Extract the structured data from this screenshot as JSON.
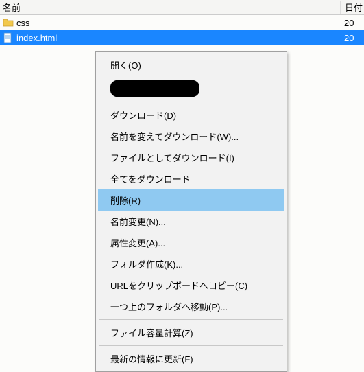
{
  "columns": {
    "name": "名前",
    "date": "日付"
  },
  "files": [
    {
      "name": "css",
      "icon": "folder-icon",
      "date": "20",
      "selected": false
    },
    {
      "name": "index.html",
      "icon": "html-file-icon",
      "date": "20",
      "selected": true
    }
  ],
  "context_menu": {
    "items": [
      {
        "label": "開く(O)",
        "type": "item"
      },
      {
        "type": "redacted"
      },
      {
        "type": "sep"
      },
      {
        "label": "ダウンロード(D)",
        "type": "item"
      },
      {
        "label": "名前を変えてダウンロード(W)...",
        "type": "item"
      },
      {
        "label": "ファイルとしてダウンロード(I)",
        "type": "item"
      },
      {
        "label": "全てをダウンロード",
        "type": "item"
      },
      {
        "label": "削除(R)",
        "type": "item",
        "highlight": true
      },
      {
        "label": "名前変更(N)...",
        "type": "item"
      },
      {
        "label": "属性変更(A)...",
        "type": "item"
      },
      {
        "label": "フォルダ作成(K)...",
        "type": "item"
      },
      {
        "label": "URLをクリップボードへコピー(C)",
        "type": "item"
      },
      {
        "label": "一つ上のフォルダへ移動(P)...",
        "type": "item"
      },
      {
        "type": "sep"
      },
      {
        "label": "ファイル容量計算(Z)",
        "type": "item"
      },
      {
        "type": "sep"
      },
      {
        "label": "最新の情報に更新(F)",
        "type": "item"
      }
    ]
  }
}
